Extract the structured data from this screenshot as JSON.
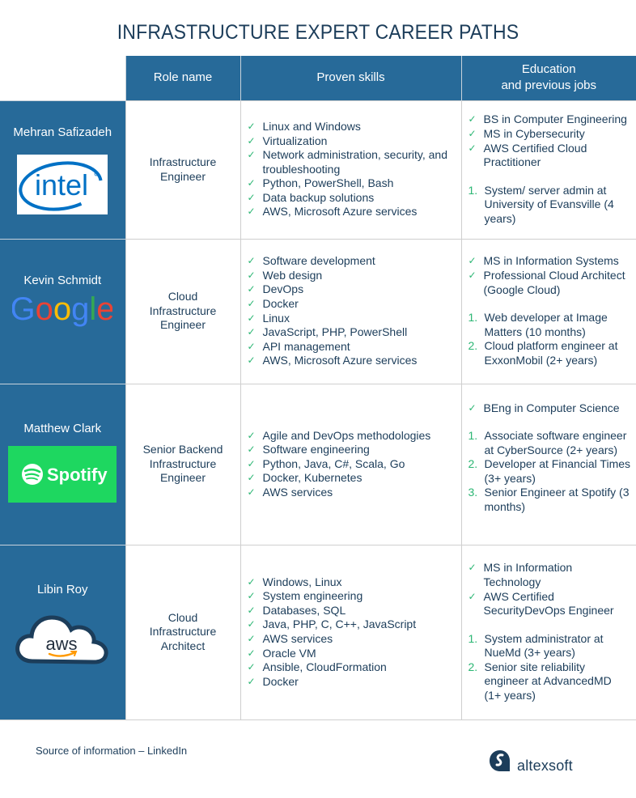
{
  "title": "INFRASTRUCTURE EXPERT CAREER PATHS",
  "columns": {
    "role": "Role name",
    "skills": "Proven skills",
    "education_line1": "Education",
    "education_line2": "and previous jobs"
  },
  "rows": [
    {
      "name": "Mehran Safizadeh",
      "company_logo": "intel-logo",
      "company": "intel",
      "role": [
        "Infrastructure",
        "Engineer"
      ],
      "skills": [
        "Linux and Windows",
        "Virtualization",
        "Network administration, security, and troubleshooting",
        "Python, PowerShell, Bash",
        "Data backup solutions",
        "AWS, Microsoft Azure services"
      ],
      "education": [
        "BS in Computer Engineering",
        "MS in Cybersecurity",
        "AWS Certified Cloud Practitioner"
      ],
      "jobs": [
        "System/ server admin at University of Evansville (4 years)"
      ]
    },
    {
      "name": "Kevin Schmidt",
      "company_logo": "google-logo",
      "company": "Google",
      "role": [
        "Cloud",
        "Infrastructure",
        "Engineer"
      ],
      "skills": [
        "Software development",
        "Web design",
        "DevOps",
        "Docker",
        "Linux",
        "JavaScript, PHP, PowerShell",
        "API management",
        "AWS, Microsoft Azure services"
      ],
      "education": [
        "MS in Information Systems",
        "Professional Cloud Architect (Google Cloud)"
      ],
      "jobs": [
        "Web developer at Image Matters (10 months)",
        "Cloud platform engineer at ExxonMobil (2+ years)"
      ]
    },
    {
      "name": "Matthew Clark",
      "company_logo": "spotify-logo",
      "company": "Spotify",
      "role": [
        "Senior Backend",
        "Infrastructure",
        "Engineer"
      ],
      "skills": [
        "Agile and DevOps methodologies",
        "Software engineering",
        "Python, Java, C#, Scala, Go",
        "Docker, Kubernetes",
        "AWS services"
      ],
      "education": [
        "BEng in Computer Science"
      ],
      "jobs": [
        "Associate software engineer at CyberSource (2+ years)",
        "Developer at Financial Times (3+ years)",
        "Senior Engineer at Spotify (3 months)"
      ]
    },
    {
      "name": "Libin Roy",
      "company_logo": "aws-logo",
      "company": "aws",
      "role": [
        "Cloud",
        "Infrastructure",
        "Architect"
      ],
      "skills": [
        "Windows, Linux",
        "System engineering",
        "Databases, SQL",
        "Java, PHP, C, C++, JavaScript",
        "AWS services",
        "Oracle VM",
        "Ansible, CloudFormation",
        "Docker"
      ],
      "education": [
        "MS in Information Technology",
        "AWS Certified SecurityDevOps Engineer"
      ],
      "jobs": [
        "System administrator at NueMd (3+ years)",
        "Senior site reliability engineer at AdvancedMD (1+ years)"
      ]
    }
  ],
  "icons": {
    "check": "✓"
  },
  "footer": {
    "source": "Source of information – LinkedIn",
    "brand": "altexsoft"
  },
  "colors": {
    "header_bg": "#276a99",
    "text": "#1c3d5a",
    "check": "#2bb673",
    "spotify_green": "#1ed760",
    "intel_blue": "#0071c5",
    "aws_orange": "#ff9900"
  }
}
